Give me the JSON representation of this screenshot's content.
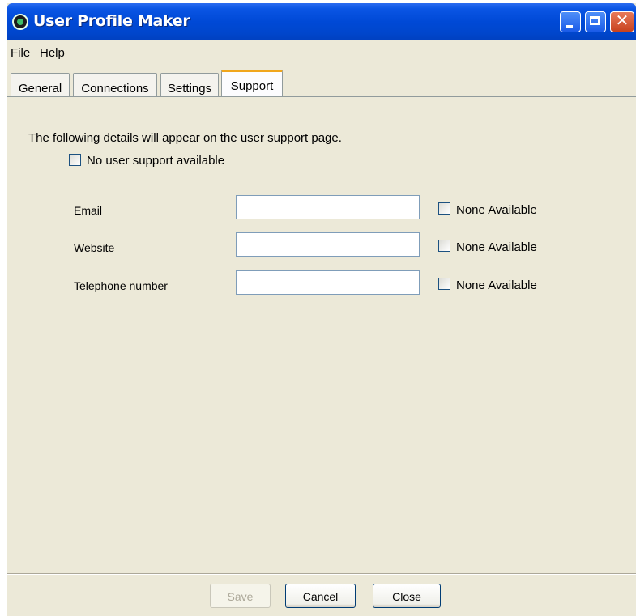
{
  "window": {
    "title": "User Profile Maker"
  },
  "menu": {
    "items": [
      "File",
      "Help"
    ]
  },
  "tabs": [
    {
      "label": "General",
      "active": false
    },
    {
      "label": "Connections",
      "active": false
    },
    {
      "label": "Settings",
      "active": false
    },
    {
      "label": "Support",
      "active": true
    }
  ],
  "support": {
    "intro": "The following details will appear on the user support page.",
    "no_support_label": "No user support available",
    "no_support_checked": false,
    "fields": [
      {
        "label": "Email",
        "value": "",
        "none_label": "None Available",
        "none_checked": false
      },
      {
        "label": "Website",
        "value": "",
        "none_label": "None Available",
        "none_checked": false
      },
      {
        "label": "Telephone number",
        "value": "",
        "none_label": "None Available",
        "none_checked": false
      }
    ]
  },
  "buttons": {
    "save": "Save",
    "cancel": "Cancel",
    "close": "Close"
  },
  "colors": {
    "title_bar": "#0049d6",
    "active_tab_accent": "#f0a61c",
    "window_bg": "#ece9d8"
  }
}
